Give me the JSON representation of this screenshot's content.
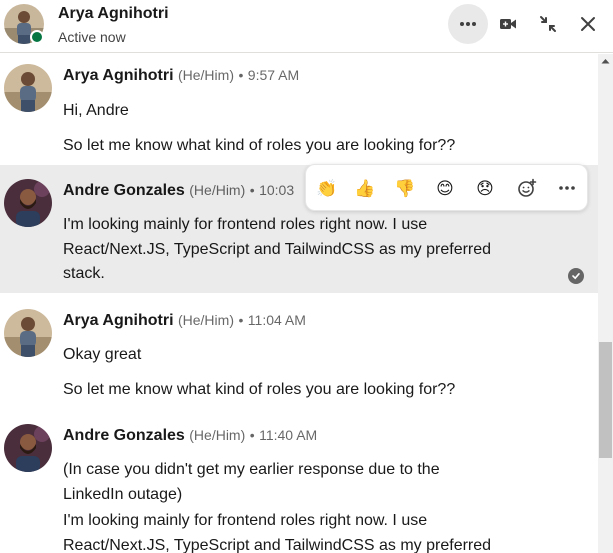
{
  "header": {
    "name": "Arya Agnihotri",
    "status": "Active now"
  },
  "colors": {
    "presence": "#057642",
    "highlight_bg": "#ebebeb",
    "muted_text": "rgba(0,0,0,0.6)"
  },
  "icons": {
    "more": "more-horizontal-icon",
    "video": "video-call-icon",
    "minimize": "minimize-icon",
    "close": "close-icon"
  },
  "messages": [
    {
      "sender": "Arya Agnihotri",
      "pronouns": "(He/Him)",
      "time": "9:57 AM",
      "lines": [
        "Hi, Andre",
        "So let me know what kind of roles you are looking for??"
      ]
    },
    {
      "sender": "Andre Gonzales",
      "pronouns": "(He/Him)",
      "time": "10:03",
      "lines": [
        "I'm looking mainly for frontend roles right now. I use React/Next.JS, TypeScript and TailwindCSS as my preferred stack."
      ]
    },
    {
      "sender": "Arya Agnihotri",
      "pronouns": "(He/Him)",
      "time": "11:04 AM",
      "lines": [
        "Okay great",
        "So let me know what kind of roles you are looking for??"
      ]
    },
    {
      "sender": "Andre Gonzales",
      "pronouns": "(He/Him)",
      "time": "11:40 AM",
      "lines": [
        "(In case you didn't get my earlier response due to the LinkedIn outage)",
        "I'm looking mainly for frontend roles right now. I use React/Next.JS, TypeScript and TailwindCSS as my preferred"
      ]
    }
  ],
  "reactions": [
    "clap-icon",
    "thumbs-up-icon",
    "thumbs-down-icon",
    "smile-icon",
    "sad-icon",
    "add-reaction-icon",
    "more-horizontal-icon"
  ],
  "separator": "•"
}
